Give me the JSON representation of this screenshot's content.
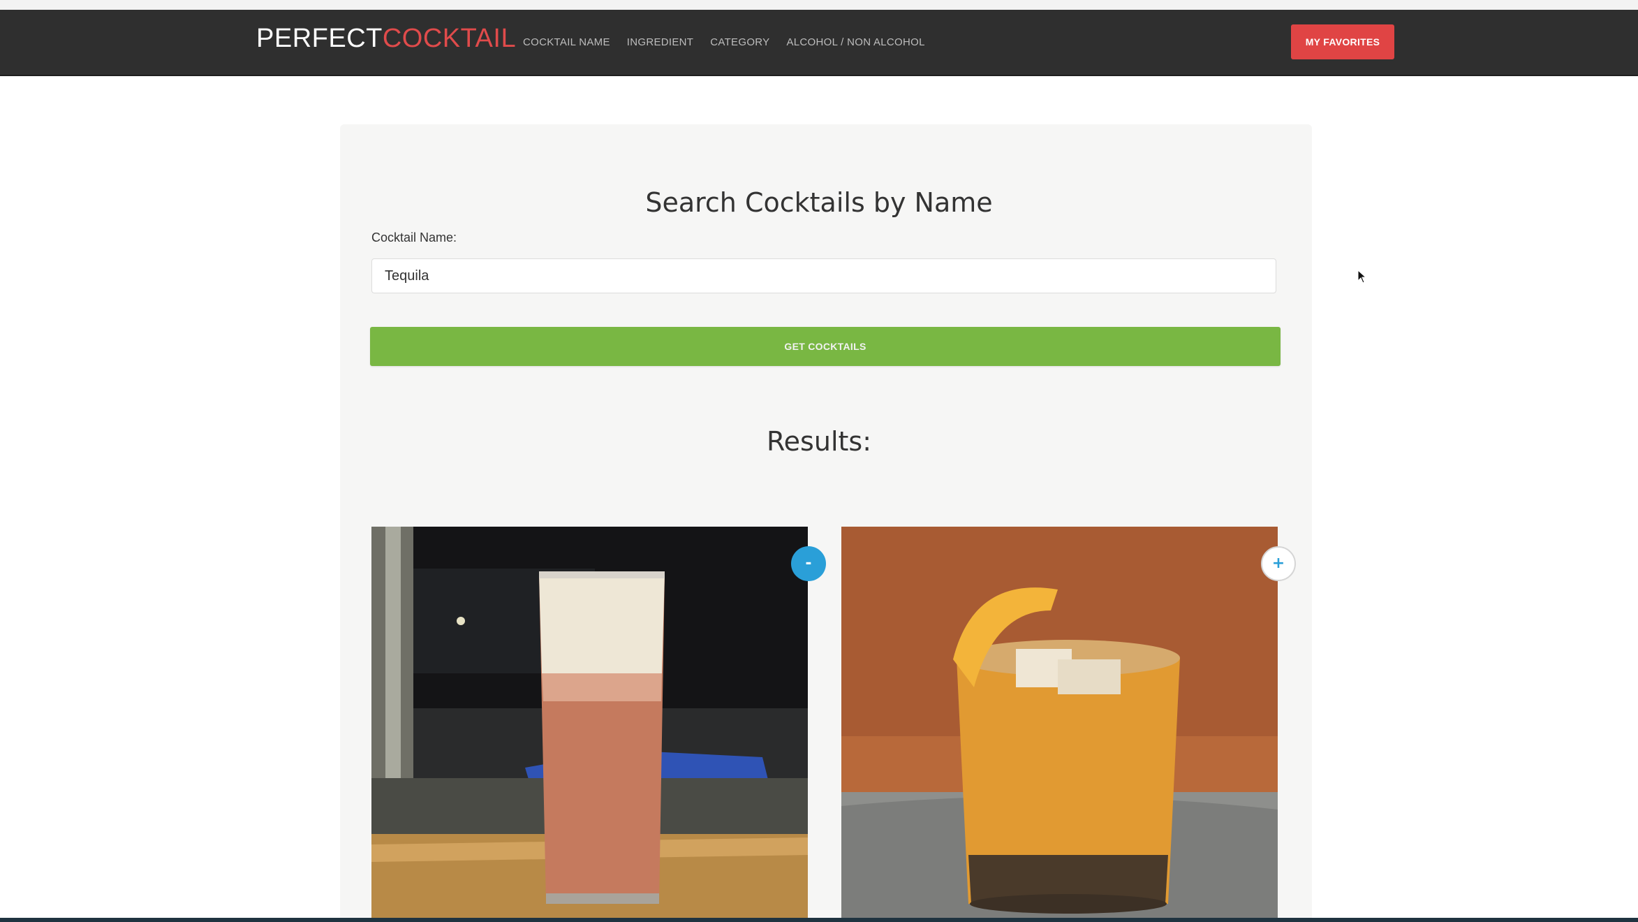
{
  "brand": {
    "part1": "PERFECT",
    "part2": "COCKTAIL",
    "accent_color": "#e04b4b"
  },
  "nav": {
    "links": [
      "COCKTAIL NAME",
      "INGREDIENT",
      "CATEGORY",
      "ALCOHOL / NON ALCOHOL"
    ],
    "favorites_button": "MY FAVORITES",
    "bar_color": "#2f2f2f"
  },
  "search": {
    "title": "Search Cocktails by Name",
    "label": "Cocktail Name:",
    "value": "Tequila",
    "button": "GET COCKTAILS",
    "button_color": "#79b743"
  },
  "results": {
    "heading": "Results:",
    "cards": [
      {
        "favorite_state": "remove",
        "toggle_symbol": "-",
        "toggle_icon": "minus-icon",
        "image": "tall glass of tequila cocktail on wooden board"
      },
      {
        "favorite_state": "add",
        "toggle_symbol": "+",
        "toggle_icon": "plus-icon",
        "image": "rocks glass of orange tequila cocktail with lemon wedge"
      }
    ]
  }
}
